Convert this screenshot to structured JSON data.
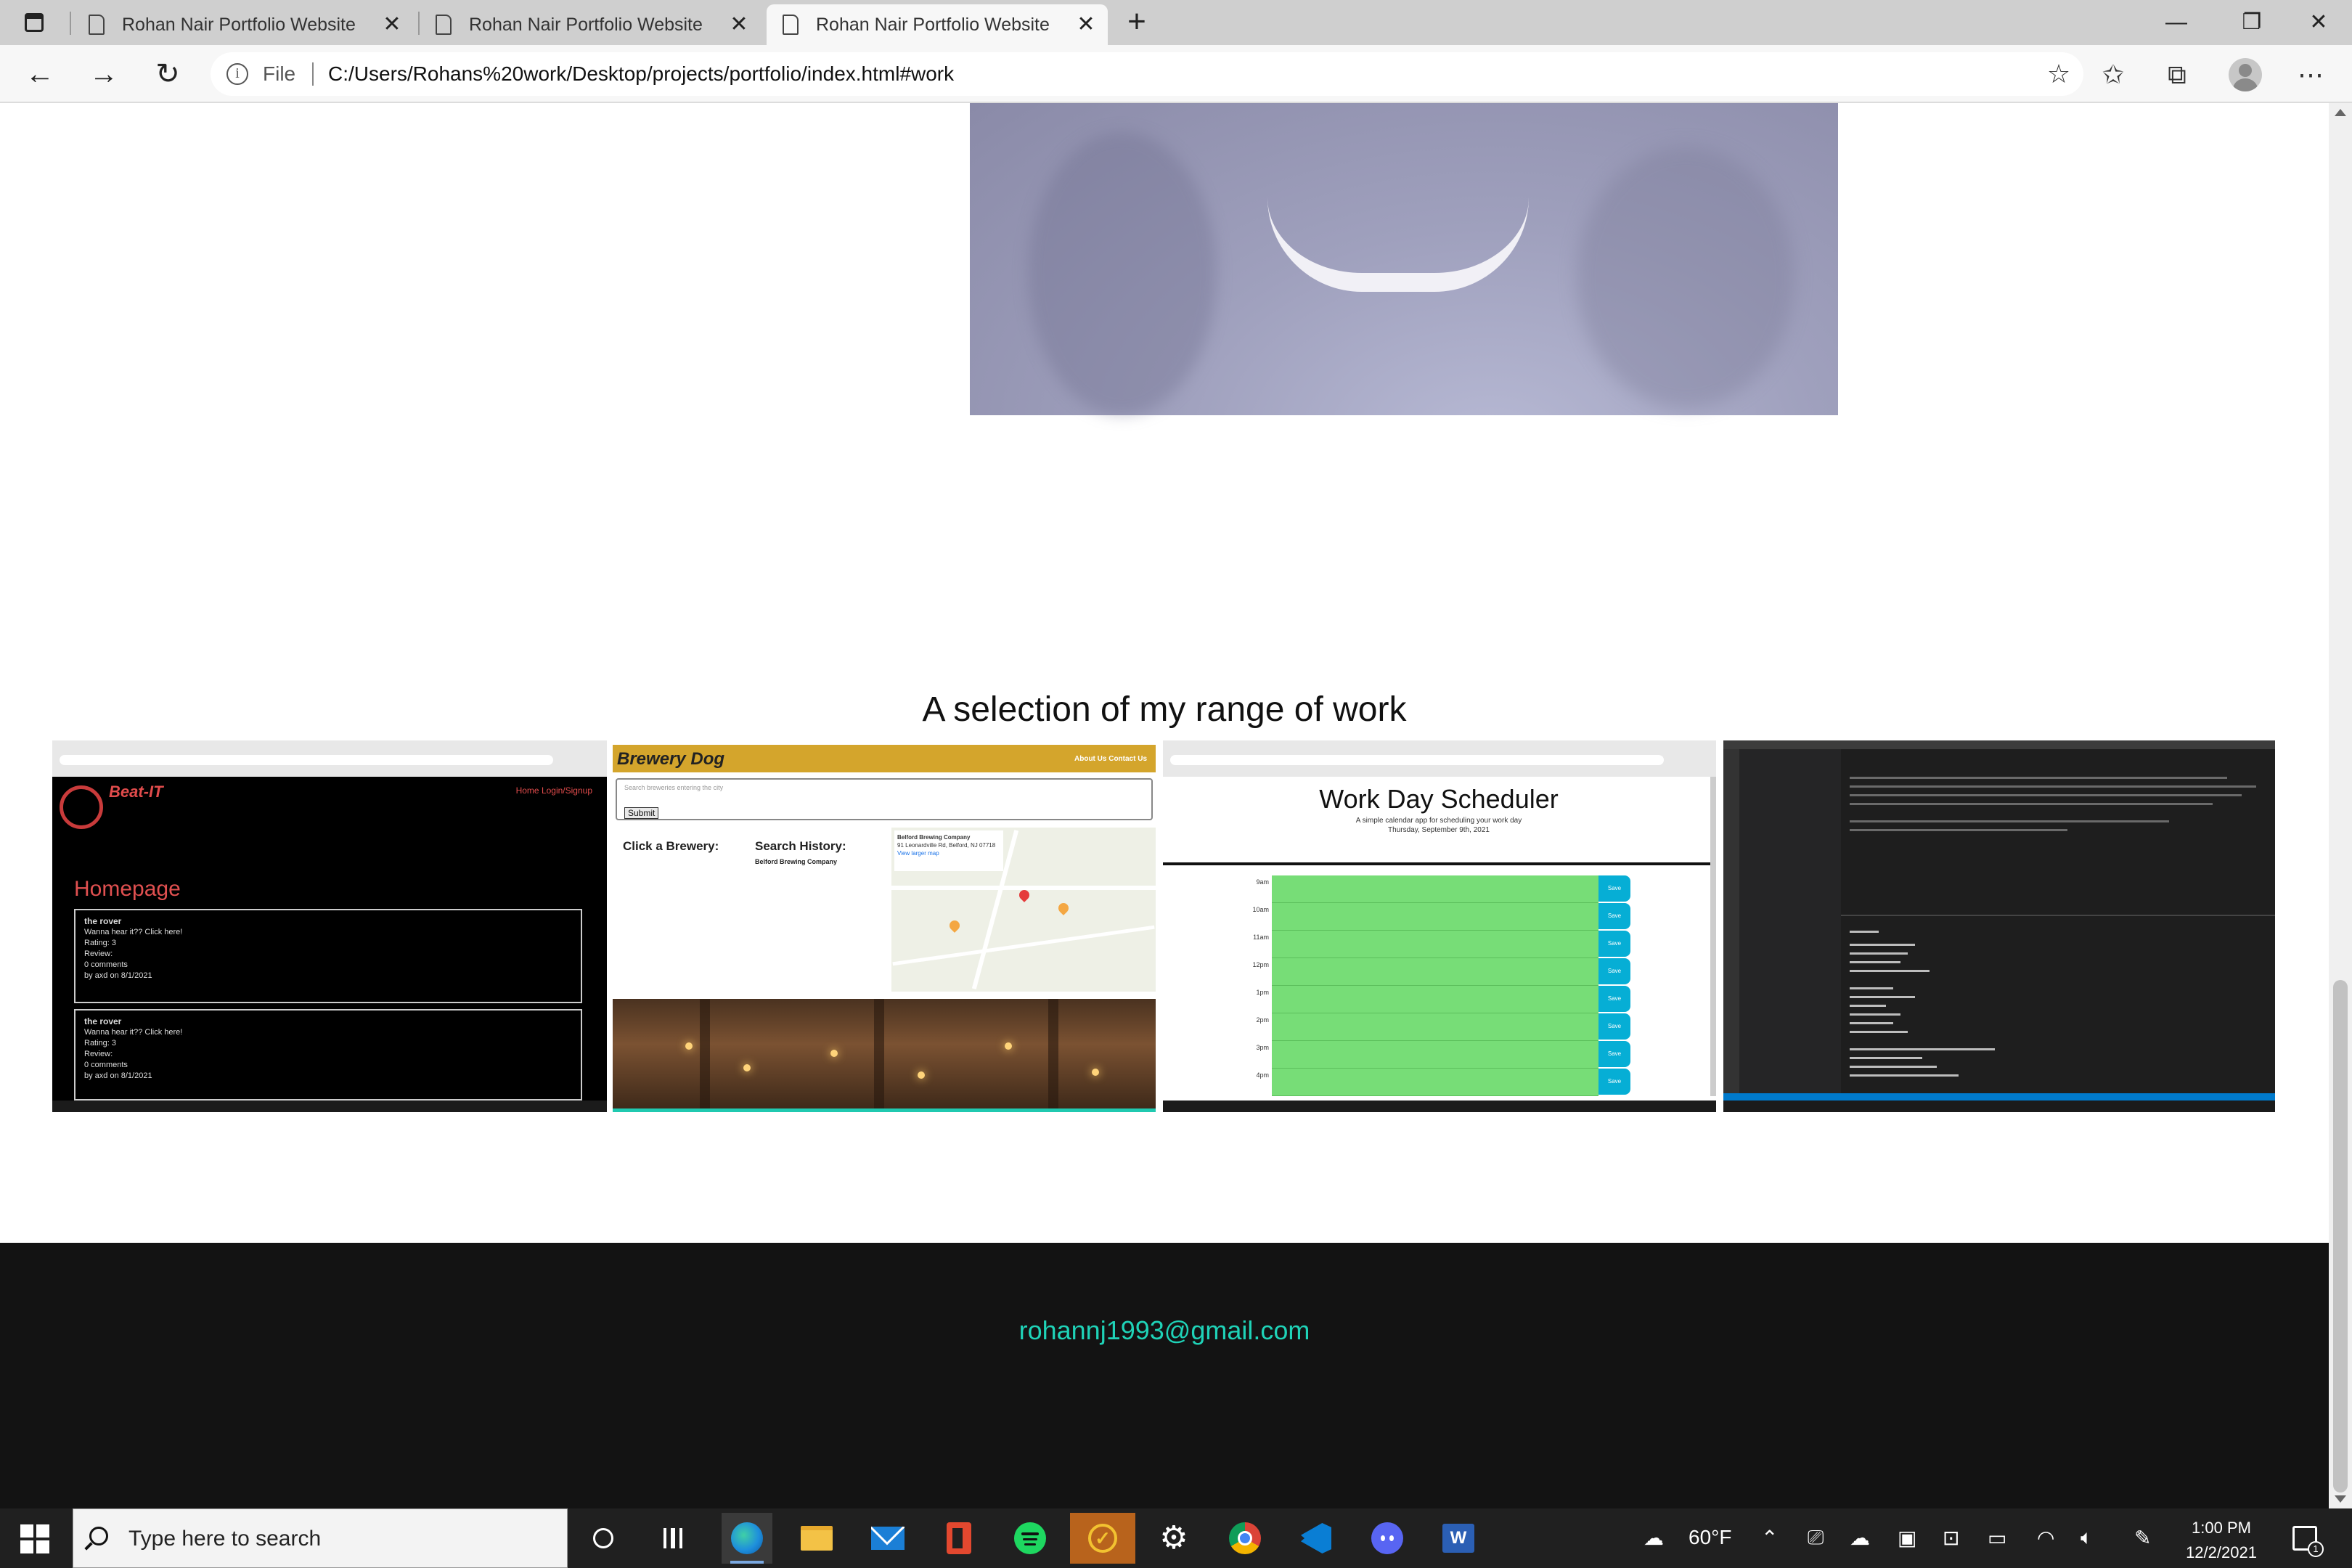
{
  "browser": {
    "tabs": [
      {
        "title": "Rohan Nair Portfolio Website",
        "active": false
      },
      {
        "title": "Rohan Nair Portfolio Website",
        "active": false
      },
      {
        "title": "Rohan Nair Portfolio Website",
        "active": true
      }
    ],
    "new_tab_icon": "+",
    "window_controls": {
      "minimize": "—",
      "restore": "❐",
      "close": "✕"
    },
    "nav": {
      "back": "←",
      "forward": "→",
      "refresh": "↻"
    },
    "file_label": "File",
    "url": "C:/Users/Rohans%20work/Desktop/projects/portfolio/index.html#work",
    "toolbar_icons": [
      "add-favorite-icon",
      "favorites-icon",
      "collections-icon",
      "profile-icon",
      "more-icon"
    ],
    "more_label": "⋯"
  },
  "page": {
    "work_heading": "A selection of my range of work",
    "projects": [
      {
        "name": "beat-it",
        "brand": "Beat-IT",
        "nav": "Home   Login/Signup",
        "heading": "Homepage",
        "cards": [
          {
            "title": "the rover",
            "lines": [
              "Wanna hear it?? Click here!",
              "Rating: 3",
              "Review:",
              "0 comments",
              "by axd on 8/1/2021"
            ]
          },
          {
            "title": "the rover",
            "lines": [
              "Wanna hear it?? Click here!",
              "Rating: 3",
              "Review:",
              "0 comments",
              "by axd on 8/1/2021"
            ]
          }
        ]
      },
      {
        "name": "brewery-dog",
        "brand": "Brewery Dog",
        "links": "About Us    Contact Us",
        "search_placeholder": "Search breweries entering the city",
        "submit": "Submit",
        "click_label": "Click a Brewery:",
        "history_label": "Search History:",
        "history_item": "Belford Brewing Company",
        "map_card_title": "Belford Brewing Company",
        "map_card_address": "91 Leonardville Rd, Belford, NJ 07718",
        "map_card_link": "View larger map"
      },
      {
        "name": "work-day-scheduler",
        "title": "Work Day Scheduler",
        "subtitle": "A simple calendar app for scheduling your work day",
        "date": "Thursday, September 9th, 2021",
        "hours": [
          "9am",
          "10am",
          "11am",
          "12pm",
          "1pm",
          "2pm",
          "3pm",
          "4pm"
        ],
        "save_label": "Save"
      },
      {
        "name": "employee-tracker-vscode"
      }
    ]
  },
  "footer": {
    "email": "rohannj1993@gmail.com"
  },
  "taskbar": {
    "search_placeholder": "Type here to search",
    "apps": [
      "cortana-icon",
      "task-view-icon",
      "edge-icon",
      "file-explorer-icon",
      "mail-icon",
      "office-icon",
      "spotify-icon",
      "norton-icon",
      "settings-icon",
      "chrome-icon",
      "vscode-icon",
      "discord-icon",
      "word-icon"
    ],
    "weather": "60°F",
    "time": "1:00 PM",
    "date": "12/2/2021",
    "notification_count": "1"
  },
  "colors": {
    "footer_bg": "#131313",
    "email_color": "#1fd3b8",
    "scheduler_green": "#77dd77",
    "scheduler_save": "#06aed5",
    "brewery_gold": "#d4a52c"
  }
}
